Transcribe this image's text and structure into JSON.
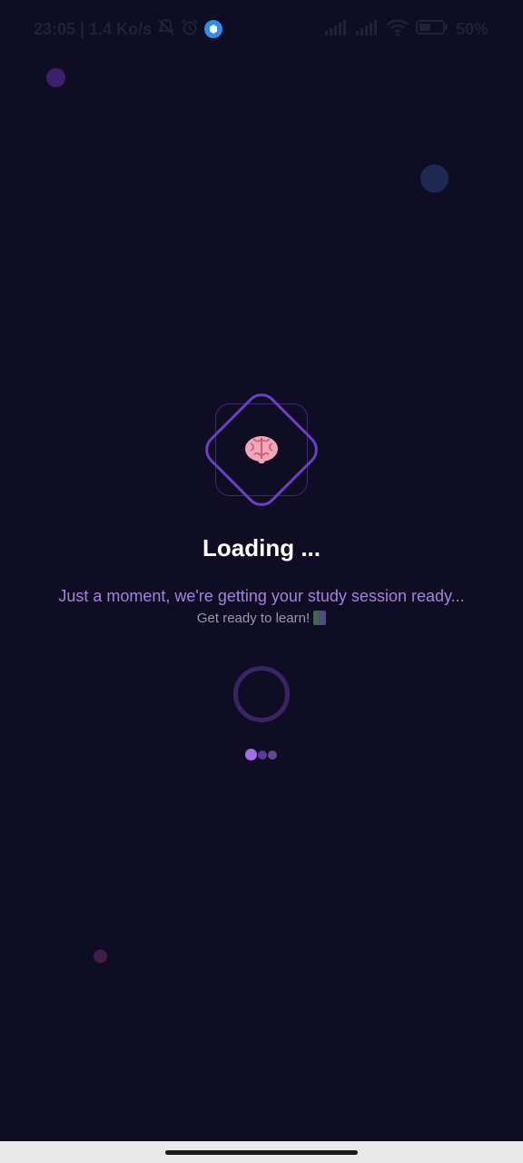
{
  "status_bar": {
    "time_and_speed": "23:05 | 1,4 Ko/s",
    "battery": "50"
  },
  "loading": {
    "logo_icon": "brain-icon",
    "title": "Loading ...",
    "subtitle": "Just a moment, we're getting your study session ready...",
    "hint": "Get ready to learn!",
    "hint_icon": "books-icon"
  },
  "colors": {
    "background": "#0f0d24",
    "accent": "#6c3fc4",
    "subtitle": "#a882d9",
    "dot_active": "#a66be8"
  }
}
